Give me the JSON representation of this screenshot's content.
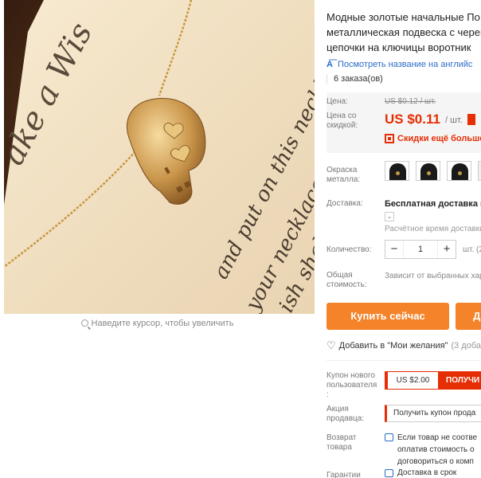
{
  "gallery": {
    "card_text": {
      "line_top": "ake a Wis",
      "line_middle": "and put on this necklace.",
      "line_mid2": "your necklace w",
      "line_bottom": "ish shall"
    },
    "zoom_hint": "Наведите курсор, чтобы увеличить"
  },
  "product": {
    "title_lines": [
      "Модные золотые начальные По",
      "металлическая подвеска с череп",
      "цепочки на ключицы воротник"
    ],
    "translate_link": "Посмотреть название на английс",
    "translate_icon": "translate-icon",
    "orders": "6 заказа(ов)"
  },
  "price": {
    "old_label": "Цена:",
    "old_value": "US $0.12 / шт.",
    "new_label_lines": [
      "Цена со",
      "скидкой:"
    ],
    "new_value": "US $0.11",
    "per_unit": "/ шт.",
    "qr_text": "Скидки ещё больше в",
    "accent_color": "#e62e04"
  },
  "options": {
    "color_label_lines": [
      "Окраска",
      "металла:"
    ],
    "delivery_label": "Доставка:",
    "delivery_free": "Бесплатная доставка в",
    "delivery_eta": "Расчётное время доставки",
    "quantity_label": "Количество:",
    "quantity_minus": "−",
    "quantity_value": "1",
    "quantity_plus": "+",
    "quantity_unit": "шт. (2",
    "total_label_lines": [
      "Общая",
      "стоимость:"
    ],
    "total_value": "Зависит от выбранных хар"
  },
  "actions": {
    "buy_now": "Купить сейчас",
    "add_to_cart": "Д",
    "button_color": "#f4832a",
    "wishlist": "Добавить в \"Мои желания\"",
    "wishlist_count": "(3 доба"
  },
  "coupons": {
    "new_user_label_lines": [
      "Купон нового",
      "пользователя",
      ":"
    ],
    "new_user_amount": "US $2.00",
    "new_user_get": "ПОЛУЧИ",
    "seller_label_lines": [
      "Акция",
      "продавца:"
    ],
    "seller_get": "Получить купон прода"
  },
  "returns": {
    "label_lines": [
      "Возврат",
      "товара"
    ],
    "text_lines": [
      "Если товар не соотве",
      "оплатив стоимость о",
      "договориться о комп"
    ],
    "guarantee_label": "Гарантии",
    "guarantee_text": "Доставка в срок"
  }
}
